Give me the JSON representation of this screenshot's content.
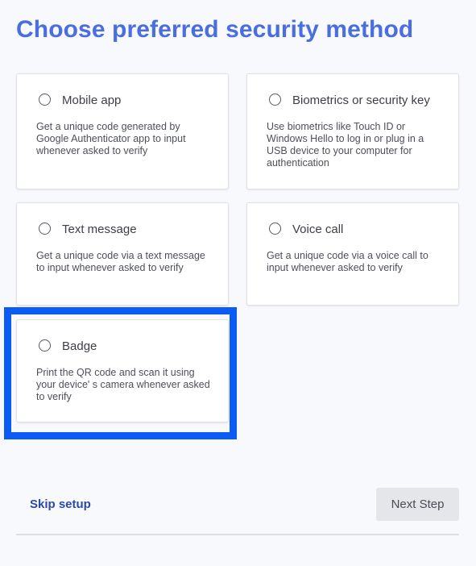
{
  "page": {
    "title": "Choose preferred security method"
  },
  "methods": [
    {
      "title": "Mobile app",
      "description": "Get a unique code generated by Google Authenticator app to input whenever asked to verify",
      "selected": false
    },
    {
      "title": "Biometrics or security key",
      "description": "Use biometrics like Touch ID or Windows Hello to log in or plug in a USB device to your computer for authentication",
      "selected": false
    },
    {
      "title": "Text message",
      "description": "Get a unique code via a text message to input whenever asked to verify",
      "selected": false
    },
    {
      "title": "Voice call",
      "description": "Get a unique code via a voice call to input whenever asked to verify",
      "selected": false
    },
    {
      "title": "Badge",
      "description": "Print the QR code and scan it using your device' s camera whenever asked to verify",
      "selected": false
    }
  ],
  "footer": {
    "skip_label": "Skip setup",
    "next_label": "Next Step",
    "next_disabled": true
  },
  "colors": {
    "title": "#4a6ee0",
    "link": "#2b4aa8",
    "highlight": "#0a5cf5",
    "button_disabled_bg": "#e4e6ea"
  },
  "icons": {
    "radio": "radio-unchecked-icon"
  }
}
